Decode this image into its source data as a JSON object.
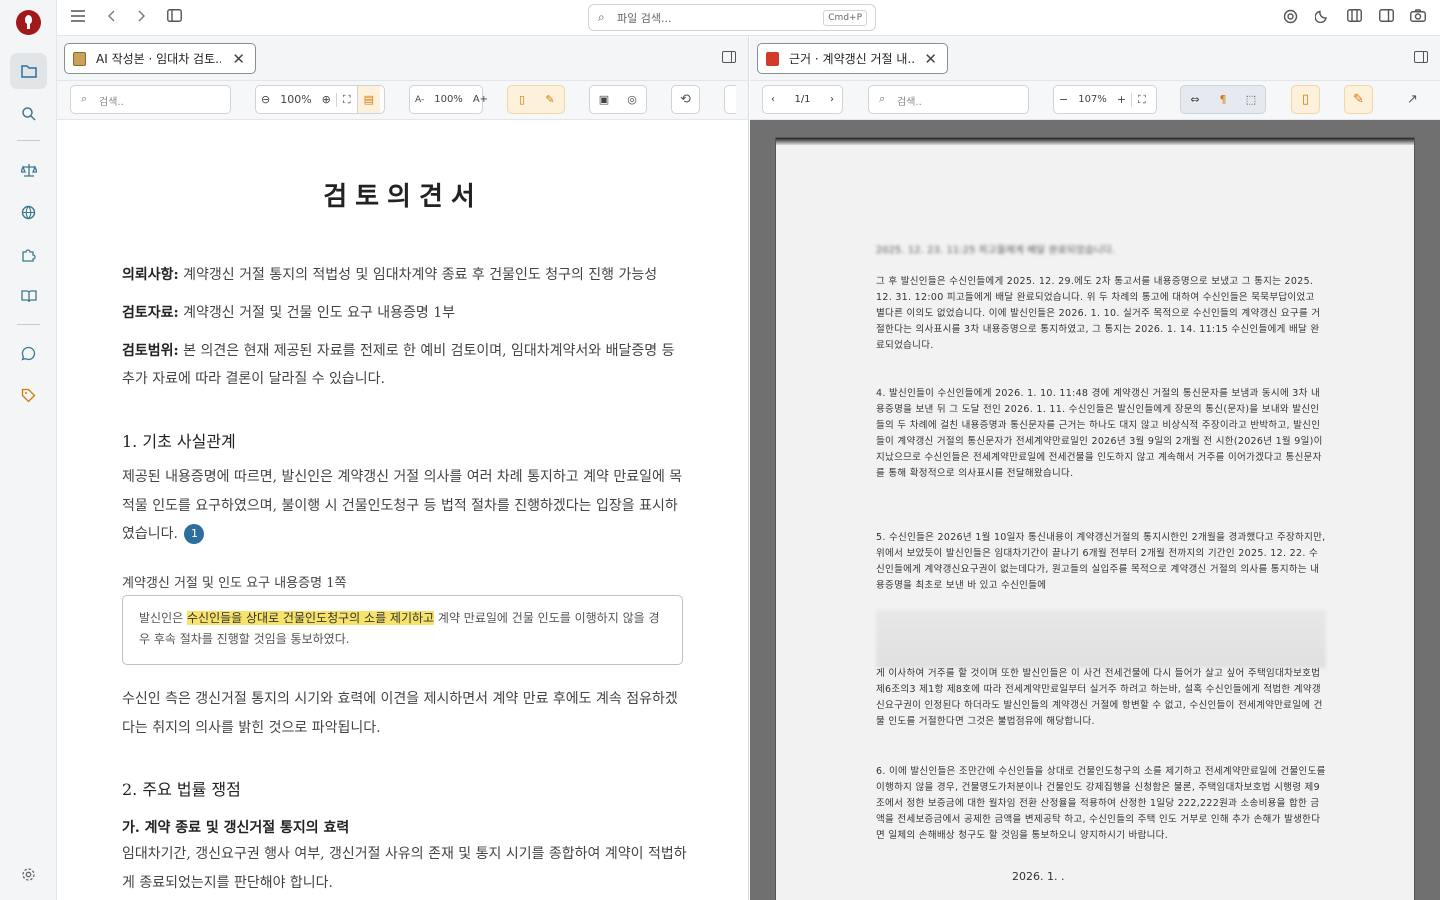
{
  "topbar": {
    "search_placeholder": "파일 검색...",
    "search_shortcut": "Cmd+P"
  },
  "left_pane": {
    "tab_title": "AI 작성본 · 임대차 검토...",
    "search_placeholder": "검색..",
    "zoom": "100%",
    "font_zoom": "100%",
    "font_dec": "A-",
    "font_inc": "A+",
    "doc": {
      "title": "검토의견서",
      "request_label": "의뢰사항:",
      "request_text": "계약갱신 거절 통지의 적법성 및 임대차계약 종료 후 건물인도 청구의 진행 가능성",
      "material_label": "검토자료:",
      "material_text": "계약갱신 거절 및 건물 인도 요구 내용증명 1부",
      "scope_label": "검토범위:",
      "scope_text": "본 의견은 현재 제공된 자료를 전제로 한 예비 검토이며, 임대차계약서와 배달증명 등 추가 자료에 따라 결론이 달라질 수 있습니다.",
      "section1_title": "1. 기초 사실관계",
      "section1_para": "제공된 내용증명에 따르면, 발신인은 계약갱신 거절 의사를 여러 차례 통지하고 계약 만료일에 목적물 인도를 요구하였으며, 불이행 시 건물인도청구 등 법적 절차를 진행하겠다는 입장을 표시하였습니다.",
      "citation_number": "1",
      "quote_label": "계약갱신 거절 및 인도 요구 내용증명 1쪽",
      "quote_before": "발신인은 ",
      "quote_highlight": "수신인들을 상대로 건물인도청구의 소를 제기하고",
      "quote_after": " 계약 만료일에 건물 인도를 이행하지 않을 경우 후속 절차를 진행할 것임을 통보하였다.",
      "section1_para2": "수신인 측은 갱신거절 통지의 시기와 효력에 이견을 제시하면서 계약 만료 후에도 계속 점유하겠다는 취지의 의사를 밝힌 것으로 파악됩니다.",
      "section2_title": "2. 주요 법률 쟁점",
      "sub_title": "가. 계약 종료 및 갱신거절 통지의 효력",
      "sub_para": "임대차기간, 갱신요구권 행사 여부, 갱신거절 사유의 존재 및 통지 시기를 종합하여 계약이 적법하게 종료되었는지를 판단해야 합니다."
    }
  },
  "right_pane": {
    "tab_title": "근거 · 계약갱신 거절 내...",
    "page_indicator": "1/1",
    "search_placeholder": "검색..",
    "zoom": "107%",
    "scan": {
      "line0": "2025. 12. 23. 11:25 피고들에게 배달 완료되었습니다.",
      "p3": "그 후 발신인들은 수신인들에게 2025. 12. 29.에도 2차 통고서를 내용증명으로 보냈고 그 통지는 2025. 12. 31. 12:00 피고들에게 배달 완료되었습니다. 위 두 차례의 통고에 대하여 수신인들은 묵묵부답이었고 별다른 이의도 없었습니다. 이에 발신인들은 2026. 1. 10. 실거주 목적으로 수신인들의 계약갱신 요구를 거절한다는 의사표시를 3차 내용증명으로 통지하였고, 그 통지는 2026. 1. 14. 11:15 수신인들에게 배달 완료되었습니다.",
      "p4": "4. 발신인들이 수신인들에게 2026. 1. 10. 11:48 경에 계약갱신 거절의 통신문자를 보냄과 동시에 3차 내용증명을 보낸 뒤 그 도달 전인 2026. 1. 11. 수신인들은 발신인들에게 장문의 통신(문자)을 보내와 발신인들의 두 차례에 걸친 내용증명과 통신문자를 근거는 하나도 대지 않고 비상식적 주장이라고 반박하고, 발신인들이 계약갱신 거절의 통신문자가 전세계약만료일인 2026년 3월 9일의 2개월 전 시한(2026년 1월 9일)이 지났으므로 수신인들은 전세계약만료일에 전세건물을 인도하지 않고 계속해서 거주를 이어가겠다고 통신문자를 통해 확정적으로 의사표시를 전달해왔습니다.",
      "p5": "5. 수신인들은 2026년 1월 10일자 통신내용이 계약갱신거절의 통지시한인 2개월을 경과했다고 주장하지만, 위에서 보았듯이 발신인들은 임대차기간이 끝나기 6개월 전부터 2개월 전까지의 기간인 2025. 12. 22. 수신인들에게 계약갱신요구권이 없는데다가, 원고들의 실입주를 목적으로 계약갱신 거절의 의사를 통지하는 내용증명을 최초로 보낸 바 있고 수신인들에",
      "p5b": "게 이사하여 거주를 할 것이며 또한 발신인들은 이 사건 전세건물에 다시 들어가 살고 싶어 주택임대차보호법 제6조의3 제1항 제8호에 따라 전세계약만료일부터 실거주 하려고 하는바, 설혹 수신인들에게 적법한 계약갱신요구권이 인정된다 하더라도 발신인들의 계약갱신 거절에 항변할 수 없고, 수신인들이 전세계약만료일에 건물 인도를 거절한다면 그것은 불법점유에 해당합니다.",
      "p6": "6. 이에 발신인들은 조만간에 수신인들을 상대로 건물인도청구의 소를 제기하고 전세계약만료일에 건물인도를 이행하지 않을 경우, 건물명도가처분이나 건물인도 강제집행을 신청함은 물론, 주택임대차보호법 시행령 제9조에서 정한 보증금에 대한 월차임 전환 산정율을 적용하여 산정한 1일당 222,222원과 소송비용을 합한 금액을 전세보증금에서 공제한 금액을 변제공탁 하고, 수신인들의 주택 인도 거부로 인해 추가 손해가 발생한다면 일체의 손해배상 청구도 할 것임을 통보하오니 양지하시기 바랍니다.",
      "date": "2026.  1.    ."
    }
  },
  "colors": {
    "accent": "#3b7a8c",
    "highlight": "#f8e36a",
    "citation": "#2e6e9e",
    "brand": "#a1191c"
  }
}
